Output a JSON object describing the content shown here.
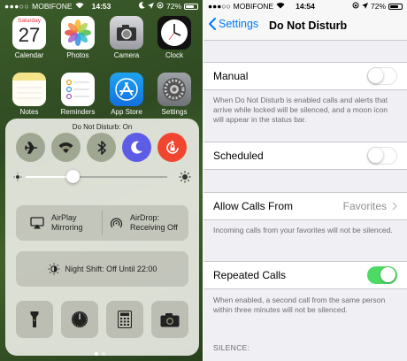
{
  "left_status": {
    "carrier": "MOBIFONE",
    "time": "14:53",
    "battery": "72%",
    "battery_level": 0.72,
    "icons": [
      "signal-dots-icon",
      "wifi-icon",
      "moon-icon",
      "location-arrow-icon",
      "lock-rotation-icon",
      "battery-icon"
    ]
  },
  "home_apps": [
    {
      "label": "Calendar",
      "icon": "calendar-icon",
      "day": "Saturday",
      "date": "27"
    },
    {
      "label": "Photos",
      "icon": "photos-icon"
    },
    {
      "label": "Camera",
      "icon": "camera-icon"
    },
    {
      "label": "Clock",
      "icon": "clock-icon"
    },
    {
      "label": "Notes",
      "icon": "notes-icon"
    },
    {
      "label": "Reminders",
      "icon": "reminders-icon"
    },
    {
      "label": "App Store",
      "icon": "app-store-icon"
    },
    {
      "label": "Settings",
      "icon": "settings-icon"
    }
  ],
  "control_center": {
    "title": "Do Not Disturb: On",
    "toggles": [
      {
        "name": "airplane",
        "icon": "airplane-icon",
        "on": false
      },
      {
        "name": "wifi",
        "icon": "wifi-icon",
        "on": false
      },
      {
        "name": "bluetooth",
        "icon": "bluetooth-icon",
        "on": false
      },
      {
        "name": "do-not-disturb",
        "icon": "moon-icon",
        "on": true,
        "color": "#5d5ce6"
      },
      {
        "name": "rotation-lock",
        "icon": "lock-rotation-icon",
        "on": true,
        "color": "#f0462f"
      }
    ],
    "brightness_level": 0.3,
    "airplay": {
      "line1": "AirPlay",
      "line2": "Mirroring"
    },
    "airdrop": {
      "line1": "AirDrop:",
      "line2": "Receiving Off"
    },
    "night_shift": "Night Shift: Off Until 22:00",
    "tools": [
      "flashlight-icon",
      "timer-icon",
      "calculator-icon",
      "camera-icon"
    ],
    "page_count": 2,
    "active_page": 1
  },
  "right_status": {
    "carrier": "MOBIFONE",
    "time": "14:54",
    "battery": "72%",
    "battery_level": 0.72
  },
  "nav": {
    "back": "Settings",
    "title": "Do Not Disturb"
  },
  "settings": {
    "manual": {
      "label": "Manual",
      "on": false
    },
    "manual_footer": "When Do Not Disturb is enabled calls and alerts that arrive while locked will be silenced, and a moon icon will appear in the status bar.",
    "scheduled": {
      "label": "Scheduled",
      "on": false
    },
    "allow_calls": {
      "label": "Allow Calls From",
      "value": "Favorites"
    },
    "allow_calls_footer": "Incoming calls from your favorites will not be silenced.",
    "repeated": {
      "label": "Repeated Calls",
      "on": true
    },
    "repeated_footer": "When enabled, a second call from the same person within three minutes will not be silenced.",
    "silence_header": "SILENCE:"
  },
  "colors": {
    "ios_blue": "#007aff",
    "switch_green": "#4cd964",
    "dnd_purple": "#5d5ce6",
    "rotation_red": "#f0462f"
  }
}
